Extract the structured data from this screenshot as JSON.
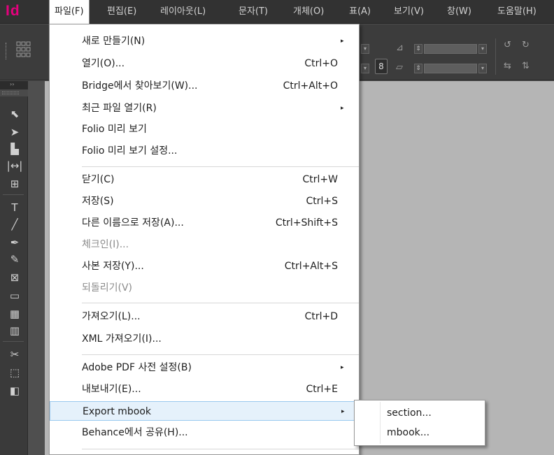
{
  "app": {
    "logo": "Id"
  },
  "menubar": [
    "파일(F)",
    "편집(E)",
    "레이아웃(L)",
    "문자(T)",
    "개체(O)",
    "표(A)",
    "보기(V)",
    "창(W)",
    "도움말(H)"
  ],
  "file_menu": {
    "items": [
      {
        "label": "새로 만들기(N)",
        "shortcut": "",
        "submenu": true,
        "enabled": true
      },
      {
        "label": "열기(O)...",
        "shortcut": "Ctrl+O",
        "submenu": false,
        "enabled": true
      },
      {
        "label": "Bridge에서 찾아보기(W)...",
        "shortcut": "Ctrl+Alt+O",
        "submenu": false,
        "enabled": true
      },
      {
        "label": "최근 파일 열기(R)",
        "shortcut": "",
        "submenu": true,
        "enabled": true
      },
      {
        "label": "Folio 미리 보기",
        "shortcut": "",
        "submenu": false,
        "enabled": true
      },
      {
        "label": "Folio 미리 보기 설정...",
        "shortcut": "",
        "submenu": false,
        "enabled": true
      },
      {
        "label": "닫기(C)",
        "shortcut": "Ctrl+W",
        "submenu": false,
        "enabled": true
      },
      {
        "label": "저장(S)",
        "shortcut": "Ctrl+S",
        "submenu": false,
        "enabled": true
      },
      {
        "label": "다른 이름으로 저장(A)...",
        "shortcut": "Ctrl+Shift+S",
        "submenu": false,
        "enabled": true
      },
      {
        "label": "체크인(I)...",
        "shortcut": "",
        "submenu": false,
        "enabled": false
      },
      {
        "label": "사본 저장(Y)...",
        "shortcut": "Ctrl+Alt+S",
        "submenu": false,
        "enabled": true
      },
      {
        "label": "되돌리기(V)",
        "shortcut": "",
        "submenu": false,
        "enabled": false
      },
      {
        "label": "가져오기(L)...",
        "shortcut": "Ctrl+D",
        "submenu": false,
        "enabled": true
      },
      {
        "label": "XML 가져오기(I)...",
        "shortcut": "",
        "submenu": false,
        "enabled": true
      },
      {
        "label": "Adobe PDF 사전 설정(B)",
        "shortcut": "",
        "submenu": true,
        "enabled": true
      },
      {
        "label": "내보내기(E)...",
        "shortcut": "Ctrl+E",
        "submenu": false,
        "enabled": true
      },
      {
        "label": "Export mbook",
        "shortcut": "",
        "submenu": true,
        "enabled": true,
        "highlighted": true
      },
      {
        "label": "Behance에서 공유(H)...",
        "shortcut": "",
        "submenu": false,
        "enabled": true
      }
    ],
    "submenu_arrow": "▸"
  },
  "export_mbook_submenu": {
    "items": [
      "section...",
      "mbook..."
    ]
  },
  "colors": {
    "logo": "#e6007e",
    "highlight_bg": "#e5f1fb",
    "highlight_border": "#99c9ef",
    "disabled_text": "#8b8b8b"
  }
}
